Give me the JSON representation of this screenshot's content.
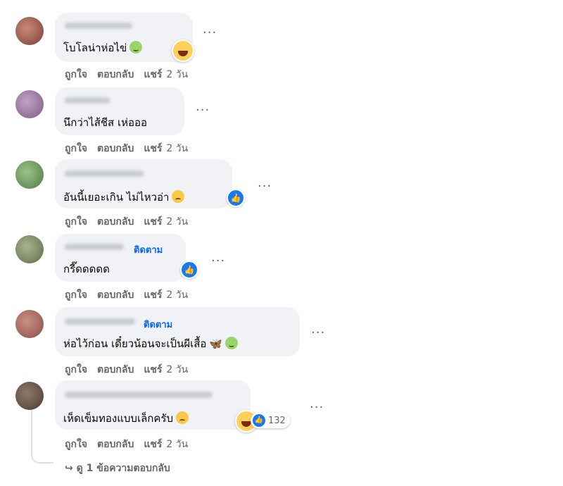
{
  "actions": {
    "like": "ถูกใจ",
    "reply": "ตอบกลับ",
    "share": "แชร์",
    "time": "2 วัน"
  },
  "follow_label": "ติดตาม",
  "comments": [
    {
      "text": "โบโลน่าห่อไข่",
      "emojis": [
        "sick-face-emoji"
      ],
      "reaction": "grin"
    },
    {
      "text": "นึกว่าไส้ชีส เห่อออ"
    },
    {
      "text": "อันนี้เยอะเกิน ไม่ไหวอ่า",
      "emojis": [
        "sad-face-emoji"
      ],
      "reaction": "like"
    },
    {
      "text": "กรี๊ดดดดด",
      "follow": true,
      "reaction": "like"
    },
    {
      "text": "ห่อไว้ก่อน เดี๋ยวน้อนจะเป็นผีเสื้อ",
      "follow": true,
      "emojis": [
        "butterfly-emoji",
        "sick-face-emoji"
      ]
    },
    {
      "text": "เห็ดเข็มทองแบบเล็กครับ",
      "emojis": [
        "sad-face-emoji"
      ],
      "reaction_count": "132"
    }
  ],
  "view_replies": "ดู 1 ข้อความตอบกลับ",
  "colors": {
    "bubble": "#f0f2f5",
    "muted": "#65676b",
    "link": "#0866ff",
    "like": "#1877f2"
  }
}
